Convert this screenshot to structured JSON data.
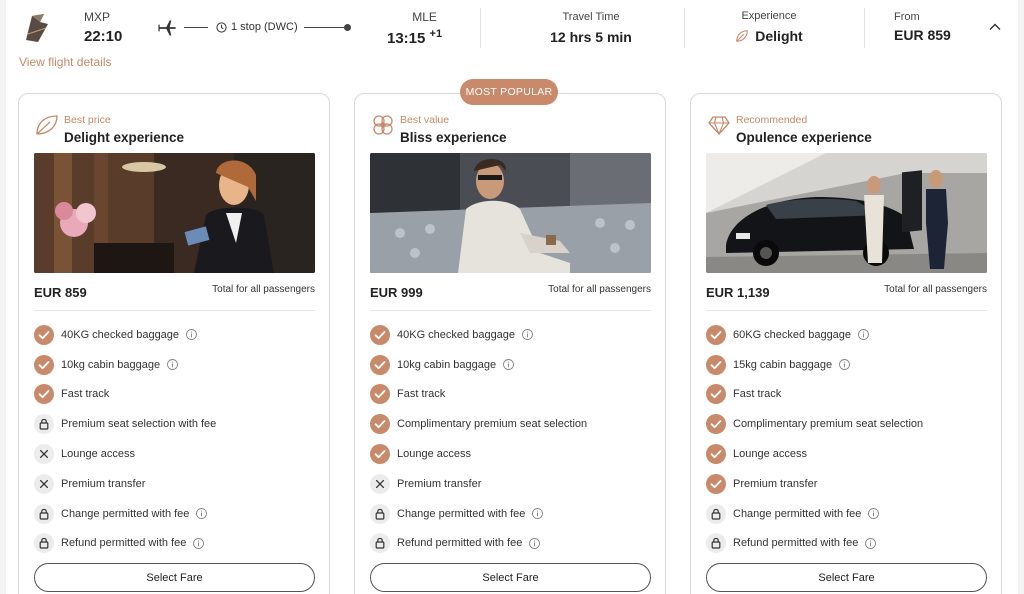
{
  "header": {
    "departure": {
      "code": "MXP",
      "time": "22:10"
    },
    "stops": "1 stop (DWC)",
    "arrival": {
      "code": "MLE",
      "time": "13:15",
      "day_offset": "+1"
    },
    "travel_time_label": "Travel Time",
    "travel_time": "12 hrs 5 min",
    "experience_label": "Experience",
    "experience": "Delight",
    "from_label": "From",
    "from_price": "EUR 859",
    "view_details": "View flight details"
  },
  "badge": "MOST POPULAR",
  "total_label": "Total for all passengers",
  "select_label": "Select Fare",
  "accent_color": "#c88a6a",
  "cards": [
    {
      "tier": "Best price",
      "title": "Delight experience",
      "icon": "leaf-icon",
      "price": "EUR 859",
      "features": [
        {
          "label": "40KG checked baggage",
          "status": "included",
          "info": true
        },
        {
          "label": "10kg cabin baggage",
          "status": "included",
          "info": true
        },
        {
          "label": "Fast track",
          "status": "included",
          "info": false
        },
        {
          "label": "Premium seat selection with fee",
          "status": "fee",
          "info": false
        },
        {
          "label": "Lounge access",
          "status": "excluded",
          "info": false
        },
        {
          "label": "Premium transfer",
          "status": "excluded",
          "info": false
        },
        {
          "label": "Change permitted with fee",
          "status": "fee",
          "info": true
        },
        {
          "label": "Refund permitted with fee",
          "status": "fee",
          "info": true
        }
      ]
    },
    {
      "tier": "Best value",
      "title": "Bliss experience",
      "icon": "flower-icon",
      "price": "EUR 999",
      "features": [
        {
          "label": "40KG checked baggage",
          "status": "included",
          "info": true
        },
        {
          "label": "10kg cabin baggage",
          "status": "included",
          "info": true
        },
        {
          "label": "Fast track",
          "status": "included",
          "info": false
        },
        {
          "label": "Complimentary premium seat selection",
          "status": "included",
          "info": false
        },
        {
          "label": "Lounge access",
          "status": "included",
          "info": false
        },
        {
          "label": "Premium transfer",
          "status": "excluded",
          "info": false
        },
        {
          "label": "Change permitted with fee",
          "status": "fee",
          "info": true
        },
        {
          "label": "Refund permitted with fee",
          "status": "fee",
          "info": true
        }
      ]
    },
    {
      "tier": "Recommended",
      "title": "Opulence experience",
      "icon": "diamond-icon",
      "price": "EUR 1,139",
      "features": [
        {
          "label": "60KG checked baggage",
          "status": "included",
          "info": true
        },
        {
          "label": "15kg cabin baggage",
          "status": "included",
          "info": true
        },
        {
          "label": "Fast track",
          "status": "included",
          "info": false
        },
        {
          "label": "Complimentary premium seat selection",
          "status": "included",
          "info": false
        },
        {
          "label": "Lounge access",
          "status": "included",
          "info": false
        },
        {
          "label": "Premium transfer",
          "status": "included",
          "info": false
        },
        {
          "label": "Change permitted with fee",
          "status": "fee",
          "info": true
        },
        {
          "label": "Refund permitted with fee",
          "status": "fee",
          "info": true
        }
      ]
    }
  ]
}
